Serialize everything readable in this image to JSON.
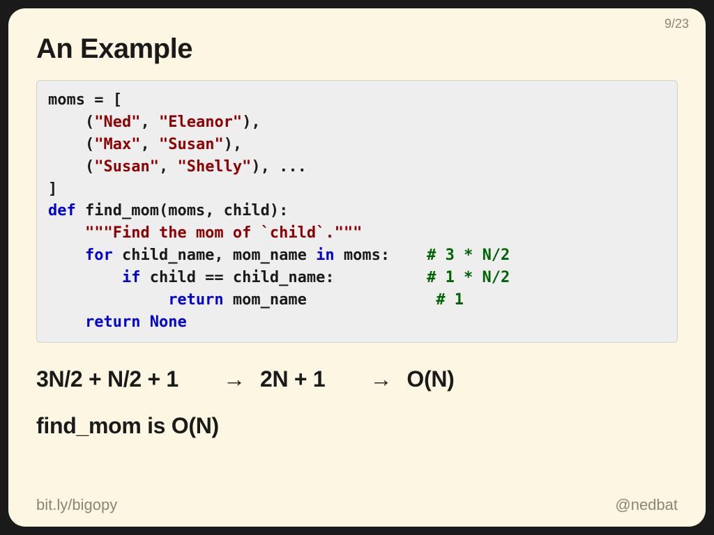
{
  "page": {
    "current": 9,
    "total": 23,
    "display": "9/23"
  },
  "title": "An Example",
  "code": {
    "l1": "moms = [",
    "l2a": "    (",
    "l2b": "\"Ned\"",
    "l2c": ", ",
    "l2d": "\"Eleanor\"",
    "l2e": "),",
    "l3a": "    (",
    "l3b": "\"Max\"",
    "l3c": ", ",
    "l3d": "\"Susan\"",
    "l3e": "),",
    "l4a": "    (",
    "l4b": "\"Susan\"",
    "l4c": ", ",
    "l4d": "\"Shelly\"",
    "l4e": "), ...",
    "l5": "]",
    "l6a": "def",
    "l6b": " find_mom(moms, child):",
    "l7a": "    ",
    "l7b": "\"\"\"Find the mom of `child`.\"\"\"",
    "l8a": "    ",
    "l8b": "for",
    "l8c": " child_name, mom_name ",
    "l8d": "in",
    "l8e": " moms:    ",
    "l8f": "# 3 * N/2",
    "l9a": "        ",
    "l9b": "if",
    "l9c": " child == child_name:          ",
    "l9d": "# 1 * N/2",
    "l10a": "             ",
    "l10b": "return",
    "l10c": " mom_name              ",
    "l10d": "# 1",
    "l11a": "    ",
    "l11b": "return",
    "l11c": " ",
    "l11d": "None"
  },
  "math": {
    "expr1": "3N/2 + N/2 + 1",
    "arrow": "→",
    "expr2": "2N + 1",
    "expr3": "O(N)"
  },
  "conclusion": "find_mom is O(N)",
  "footer": {
    "left_prefix": "bit.ly/",
    "left_slug": "bigopy",
    "right_prefix": "@",
    "right_handle": "nedbat"
  }
}
